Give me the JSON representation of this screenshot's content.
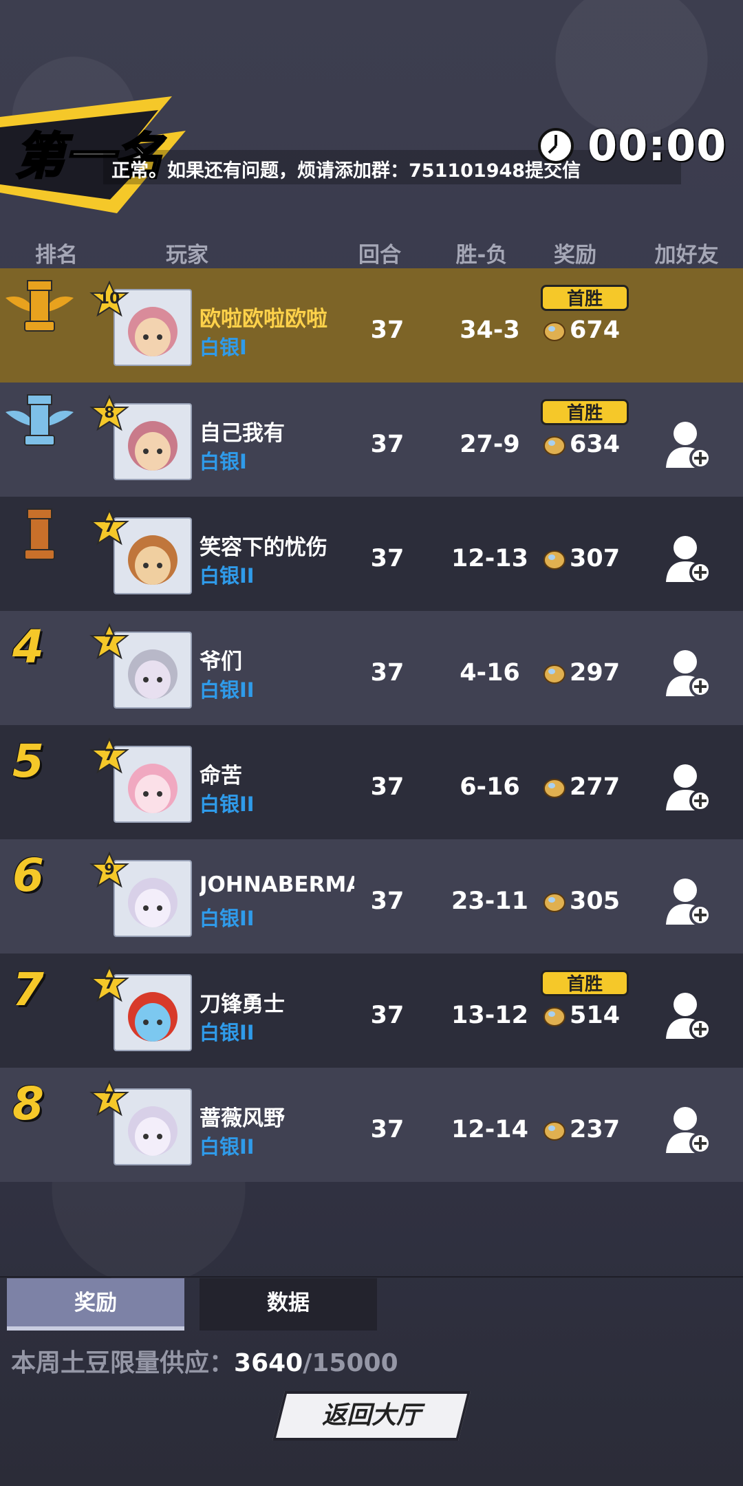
{
  "banner": {
    "title": "第一名"
  },
  "ticker": {
    "text": "正常。如果还有问题，烦请添加群：751101948提交信"
  },
  "timer": {
    "value": "00:00"
  },
  "headers": {
    "rank": "排名",
    "player": "玩家",
    "rounds": "回合",
    "win_loss": "胜-负",
    "reward": "奖励",
    "add_friend": "加好友"
  },
  "first_win_label": "首胜",
  "players": [
    {
      "rank": "1",
      "level": "10",
      "name": "欧啦欧啦欧啦",
      "tier": "白银I",
      "rounds": "37",
      "win_loss": "34-3",
      "reward": "674",
      "first_win": true,
      "can_add": false
    },
    {
      "rank": "2",
      "level": "8",
      "name": "自己我有",
      "tier": "白银I",
      "rounds": "37",
      "win_loss": "27-9",
      "reward": "634",
      "first_win": true,
      "can_add": true
    },
    {
      "rank": "3",
      "level": "7",
      "name": "笑容下的忧伤",
      "tier": "白银II",
      "rounds": "37",
      "win_loss": "12-13",
      "reward": "307",
      "first_win": false,
      "can_add": true
    },
    {
      "rank": "4",
      "level": "7",
      "name": "爷们",
      "tier": "白银II",
      "rounds": "37",
      "win_loss": "4-16",
      "reward": "297",
      "first_win": false,
      "can_add": true
    },
    {
      "rank": "5",
      "level": "7",
      "name": "命苦",
      "tier": "白银II",
      "rounds": "37",
      "win_loss": "6-16",
      "reward": "277",
      "first_win": false,
      "can_add": true
    },
    {
      "rank": "6",
      "level": "9",
      "name": "JOHNABERMA",
      "tier": "白银II",
      "rounds": "37",
      "win_loss": "23-11",
      "reward": "305",
      "first_win": false,
      "can_add": true
    },
    {
      "rank": "7",
      "level": "7",
      "name": "刀锋勇士",
      "tier": "白银II",
      "rounds": "37",
      "win_loss": "13-12",
      "reward": "514",
      "first_win": true,
      "can_add": true
    },
    {
      "rank": "8",
      "level": "7",
      "name": "蔷薇风野",
      "tier": "白银II",
      "rounds": "37",
      "win_loss": "12-14",
      "reward": "237",
      "first_win": false,
      "can_add": true
    }
  ],
  "tabs": {
    "reward": "奖励",
    "data": "数据"
  },
  "supply": {
    "label": "本周土豆限量供应：",
    "current": "3640",
    "max": "/15000"
  },
  "return_button": {
    "label": "返回大厅"
  },
  "colors": {
    "gold": "#f5c829",
    "silver_tier": "#2f9bea",
    "first_row": "#7d6427"
  }
}
